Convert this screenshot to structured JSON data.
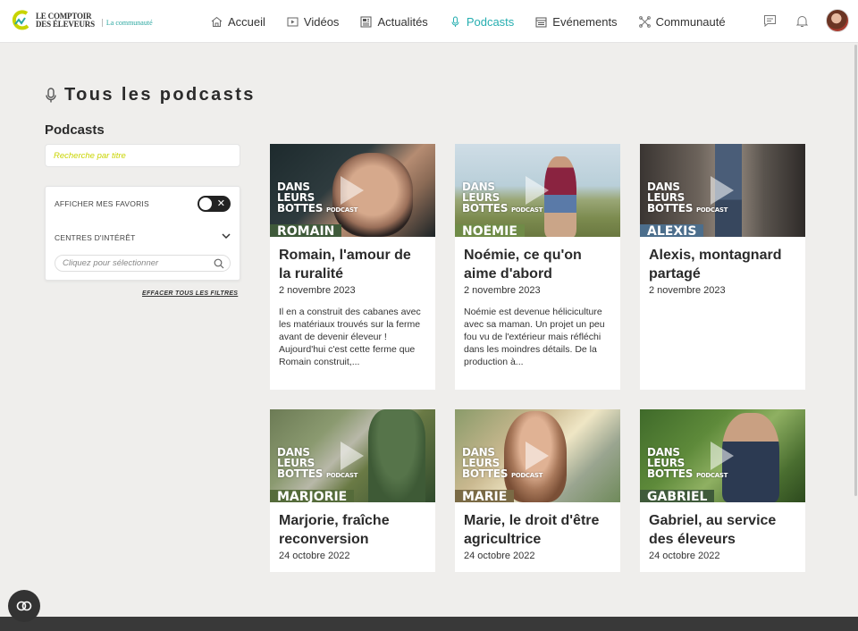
{
  "header": {
    "logo_line1": "LE COMPTOIR",
    "logo_line2": "DES ÉLEVEURS",
    "logo_sub": "La communauté",
    "nav": [
      {
        "label": "Accueil",
        "icon": "home-icon"
      },
      {
        "label": "Vidéos",
        "icon": "video-icon"
      },
      {
        "label": "Actualités",
        "icon": "news-icon"
      },
      {
        "label": "Podcasts",
        "icon": "microphone-icon",
        "active": true
      },
      {
        "label": "Evénements",
        "icon": "calendar-icon"
      },
      {
        "label": "Communauté",
        "icon": "community-icon"
      }
    ],
    "accent_color": "#26aeb0"
  },
  "page": {
    "title": "Tous les podcasts",
    "section_title": "Podcasts",
    "search_placeholder": "Recherche par titre"
  },
  "filters": {
    "favorites_label": "AFFICHER MES FAVORIS",
    "interests_label": "CENTRES D'INTÉRÊT",
    "select_placeholder": "Cliquez pour sélectionner",
    "clear_label": "EFFACER TOUS LES FILTRES"
  },
  "brand_overlay": {
    "line1": "DANS",
    "line2": "LEURS",
    "line3": "BOTTES",
    "tag": "PODCAST"
  },
  "cards": [
    {
      "name": "ROMAIN",
      "title": "Romain, l'amour de la ruralité",
      "date": "2 novembre 2023",
      "desc": "Il en a construit des cabanes avec les matériaux trouvés sur la ferme avant de devenir éleveur ! Aujourd'hui c'est cette ferme que Romain construit,...",
      "band_color": "#3f5a3a"
    },
    {
      "name": "NOÉMIE",
      "title": "Noémie, ce qu'on aime d'abord",
      "date": "2 novembre 2023",
      "desc": "Noémie est devenue héliciculture avec sa maman. Un projet un peu fou vu de l'extérieur mais réfléchi dans les moindres détails. De la production à...",
      "band_color": "#6f8b47"
    },
    {
      "name": "ALEXIS",
      "title": "Alexis, montagnard partagé",
      "date": "2 novembre 2023",
      "desc": "",
      "band_color": "#4c6e8c"
    },
    {
      "name": "MARJORIE",
      "title": "Marjorie, fraîche reconversion",
      "date": "24 octobre 2022",
      "desc": "",
      "band_color": "#556b3a"
    },
    {
      "name": "MARIE",
      "title": "Marie, le droit d'être agricultrice",
      "date": "24 octobre 2022",
      "desc": "",
      "band_color": "#7a6a45"
    },
    {
      "name": "GABRIEL",
      "title": "Gabriel, au service des éleveurs",
      "date": "24 octobre 2022",
      "desc": "",
      "band_color": "#3f5a3a"
    }
  ]
}
